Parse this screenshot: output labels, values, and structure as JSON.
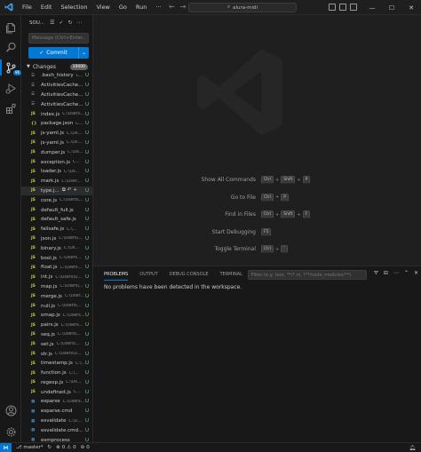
{
  "titlebar": {
    "menu": [
      "File",
      "Edit",
      "Selection",
      "View",
      "Go",
      "Run"
    ],
    "more_menu": "···",
    "search_text": "alura-midi"
  },
  "activitybar": {
    "scm_badge": "9K"
  },
  "sidebar": {
    "header_title": "SOU...",
    "message_placeholder": "Message (Ctrl+Enter...",
    "commit_label": "Commit",
    "changes_label": "Changes",
    "changes_count": "10000",
    "files": [
      {
        "icon": "txt",
        "name": ".bash_history",
        "path": "C...",
        "status": "U"
      },
      {
        "icon": "txt",
        "name": "ActivitiesCache...",
        "path": "",
        "status": "U"
      },
      {
        "icon": "txt",
        "name": "ActivitiesCache...",
        "path": "",
        "status": "U"
      },
      {
        "icon": "txt",
        "name": "ActivitiesCache...",
        "path": "",
        "status": "U"
      },
      {
        "icon": "js",
        "name": "index.js",
        "path": "C:\\Users...",
        "status": "U"
      },
      {
        "icon": "json",
        "name": "package.json",
        "path": "C...",
        "status": "U"
      },
      {
        "icon": "js",
        "name": "js-yaml.js",
        "path": "C:\\Us...",
        "status": "U"
      },
      {
        "icon": "js",
        "name": "js-yaml.js",
        "path": "C:\\Us...",
        "status": "U"
      },
      {
        "icon": "js",
        "name": "dumper.js",
        "path": "C:\\Us...",
        "status": "U"
      },
      {
        "icon": "js",
        "name": "exception.js",
        "path": "C...",
        "status": "U"
      },
      {
        "icon": "js",
        "name": "loader.js",
        "path": "C:\\Us...",
        "status": "U"
      },
      {
        "icon": "js",
        "name": "mark.js",
        "path": "C:\\User...",
        "status": "U"
      },
      {
        "icon": "js",
        "name": "type.j...",
        "path": "",
        "status": "U",
        "selected": true
      },
      {
        "icon": "js",
        "name": "core.js",
        "path": "C:\\Users\\...",
        "status": "U"
      },
      {
        "icon": "js",
        "name": "default_full.js",
        "path": "",
        "status": "U"
      },
      {
        "icon": "js",
        "name": "default_safe.js",
        "path": "",
        "status": "U"
      },
      {
        "icon": "js",
        "name": "failsafe.js",
        "path": "C:\\...",
        "status": "U"
      },
      {
        "icon": "js",
        "name": "json.js",
        "path": "C:\\Users\\...",
        "status": "U"
      },
      {
        "icon": "js",
        "name": "binary.js",
        "path": "C:\\Us...",
        "status": "U"
      },
      {
        "icon": "js",
        "name": "bool.js",
        "path": "C:\\Users...",
        "status": "U"
      },
      {
        "icon": "js",
        "name": "float.js",
        "path": "C:\\Users...",
        "status": "U"
      },
      {
        "icon": "js",
        "name": "int.js",
        "path": "C:\\Users\\U...",
        "status": "U"
      },
      {
        "icon": "js",
        "name": "map.js",
        "path": "C:\\Users\\...",
        "status": "U"
      },
      {
        "icon": "js",
        "name": "merge.js",
        "path": "C:\\User...",
        "status": "U"
      },
      {
        "icon": "js",
        "name": "null.js",
        "path": "C:\\Users\\...",
        "status": "U"
      },
      {
        "icon": "js",
        "name": "omap.js",
        "path": "C:\\Users...",
        "status": "U"
      },
      {
        "icon": "js",
        "name": "pairs.js",
        "path": "C:\\Users...",
        "status": "U"
      },
      {
        "icon": "js",
        "name": "seq.js",
        "path": "C:\\Users\\...",
        "status": "U"
      },
      {
        "icon": "js",
        "name": "set.js",
        "path": "C:\\Users\\...",
        "status": "U"
      },
      {
        "icon": "js",
        "name": "str.js",
        "path": "C:\\Users\\U...",
        "status": "U"
      },
      {
        "icon": "js",
        "name": "timestamp.js",
        "path": "C:\\...",
        "status": "U"
      },
      {
        "icon": "js",
        "name": "function.js",
        "path": "C:\\...",
        "status": "U"
      },
      {
        "icon": "js",
        "name": "regexp.js",
        "path": "C:\\Us...",
        "status": "U"
      },
      {
        "icon": "js",
        "name": "undefined.js",
        "path": "C...",
        "status": "U"
      },
      {
        "icon": "cmd",
        "name": "esparse",
        "path": "C:\\Users...",
        "status": "U"
      },
      {
        "icon": "cmd",
        "name": "esparse.cmd",
        "path": "",
        "status": "U"
      },
      {
        "icon": "cmd",
        "name": "esvalidate",
        "path": "C:\\U...",
        "status": "U"
      },
      {
        "icon": "cmd",
        "name": "esvalidate.cmd...",
        "path": "",
        "status": "U"
      },
      {
        "icon": "cmd",
        "name": "esmprocess",
        "path": "",
        "status": "U"
      }
    ]
  },
  "editor": {
    "shortcuts": [
      {
        "label": "Show All Commands",
        "keys": [
          "Ctrl",
          "Shift",
          "P"
        ]
      },
      {
        "label": "Go to File",
        "keys": [
          "Ctrl",
          "P"
        ]
      },
      {
        "label": "Find in Files",
        "keys": [
          "Ctrl",
          "Shift",
          "F"
        ]
      },
      {
        "label": "Start Debugging",
        "keys": [
          "F5"
        ]
      },
      {
        "label": "Toggle Terminal",
        "keys": [
          "Ctrl",
          "`"
        ]
      }
    ]
  },
  "panel": {
    "tabs": [
      "PROBLEMS",
      "OUTPUT",
      "DEBUG CONSOLE",
      "TERMINAL"
    ],
    "filter_placeholder": "Filter (e.g. text, **/*.ts, !**/node_modules/**)",
    "message": "No problems have been detected in the workspace."
  },
  "statusbar": {
    "branch": "master*",
    "errors": "0",
    "warnings": "0",
    "ports": "0"
  },
  "colors": {
    "accent": "#0078d4",
    "untracked": "#73c991",
    "js_icon": "#cbcb41"
  }
}
